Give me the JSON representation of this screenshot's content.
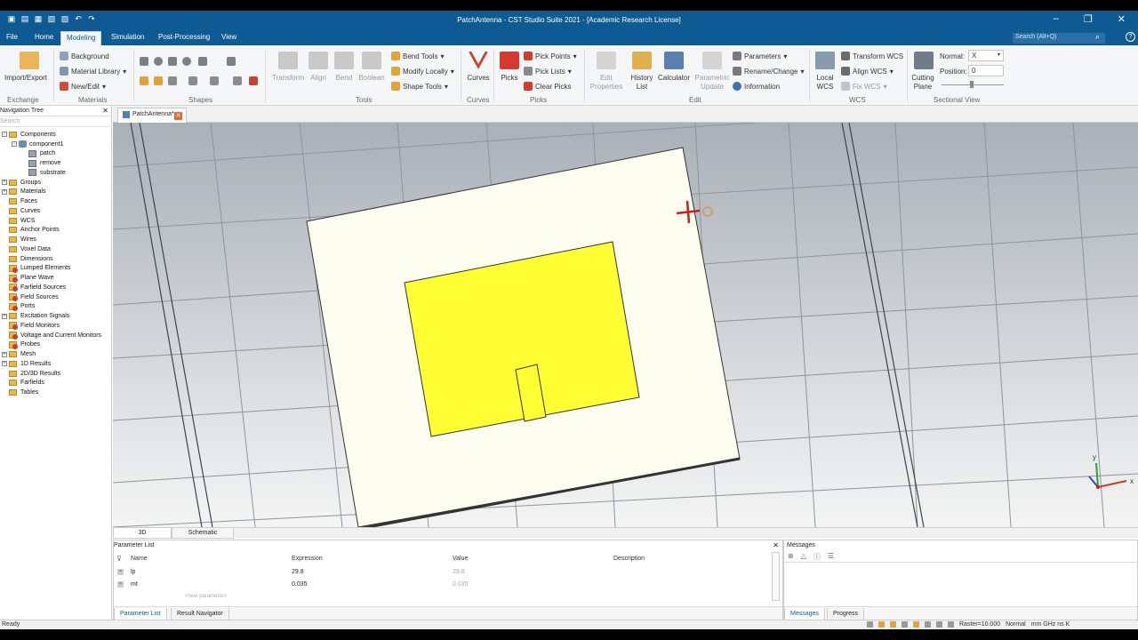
{
  "window": {
    "title": "PatchAntenna - CST Studio Suite 2021 - [Academic Research License]"
  },
  "menu": {
    "tabs": [
      "File",
      "Home",
      "Modeling",
      "Simulation",
      "Post-Processing",
      "View"
    ],
    "active": "Modeling",
    "search_placeholder": "Search (Alt+Q)"
  },
  "ribbon": {
    "exchange": {
      "import_export": "Import/Export",
      "group": "Exchange"
    },
    "materials": {
      "background": "Background",
      "library": "Material Library",
      "new_edit": "New/Edit",
      "group": "Materials"
    },
    "shapes": {
      "group": "Shapes"
    },
    "tools": {
      "transform": "Transform",
      "align": "Align",
      "bend": "Bend",
      "boolean": "Boolean",
      "bend_tools": "Bend Tools",
      "modify_locally": "Modify Locally",
      "shape_tools": "Shape Tools",
      "group": "Tools"
    },
    "curves": {
      "curves": "Curves",
      "group": "Curves"
    },
    "picks": {
      "picks": "Picks",
      "pick_points": "Pick Points",
      "pick_lists": "Pick Lists",
      "clear_picks": "Clear Picks",
      "group": "Picks"
    },
    "edit": {
      "edit_properties_1": "Edit",
      "edit_properties_2": "Properties",
      "history_1": "History",
      "history_2": "List",
      "calculator": "Calculator",
      "param_update_1": "Parametric",
      "param_update_2": "Update",
      "parameters": "Parameters",
      "rename": "Rename/Change",
      "information": "Information",
      "group": "Edit"
    },
    "wcs": {
      "local_1": "Local",
      "local_2": "WCS",
      "transform": "Transform WCS",
      "align": "Align WCS",
      "fix": "Fix WCS",
      "group": "WCS"
    },
    "sectional": {
      "cutting_1": "Cutting",
      "cutting_2": "Plane",
      "normal_label": "Normal:",
      "normal_value": "X",
      "position_label": "Position:",
      "position_value": "0",
      "group": "Sectional View"
    }
  },
  "nav": {
    "title": "Navigation Tree",
    "search_placeholder": "Search",
    "items": [
      {
        "label": "Components",
        "indent": 0,
        "icon": "folder",
        "exp": "-"
      },
      {
        "label": "component1",
        "indent": 1,
        "icon": "component",
        "exp": "-"
      },
      {
        "label": "patch",
        "indent": 2,
        "icon": "solid",
        "exp": ""
      },
      {
        "label": "remove",
        "indent": 2,
        "icon": "solid",
        "exp": ""
      },
      {
        "label": "substrate",
        "indent": 2,
        "icon": "solid",
        "exp": ""
      },
      {
        "label": "Groups",
        "indent": 0,
        "icon": "folder",
        "exp": "+"
      },
      {
        "label": "Materials",
        "indent": 0,
        "icon": "folder",
        "exp": "+"
      },
      {
        "label": "Faces",
        "indent": 0,
        "icon": "folder",
        "exp": ""
      },
      {
        "label": "Curves",
        "indent": 0,
        "icon": "folder",
        "exp": ""
      },
      {
        "label": "WCS",
        "indent": 0,
        "icon": "folder",
        "exp": ""
      },
      {
        "label": "Anchor Points",
        "indent": 0,
        "icon": "folder",
        "exp": ""
      },
      {
        "label": "Wires",
        "indent": 0,
        "icon": "folder",
        "exp": ""
      },
      {
        "label": "Voxel Data",
        "indent": 0,
        "icon": "folder",
        "exp": ""
      },
      {
        "label": "Dimensions",
        "indent": 0,
        "icon": "folder",
        "exp": ""
      },
      {
        "label": "Lumped Elements",
        "indent": 0,
        "icon": "red",
        "exp": ""
      },
      {
        "label": "Plane Wave",
        "indent": 0,
        "icon": "red",
        "exp": ""
      },
      {
        "label": "Farfield Sources",
        "indent": 0,
        "icon": "red",
        "exp": ""
      },
      {
        "label": "Field Sources",
        "indent": 0,
        "icon": "red",
        "exp": ""
      },
      {
        "label": "Ports",
        "indent": 0,
        "icon": "red",
        "exp": ""
      },
      {
        "label": "Excitation Signals",
        "indent": 0,
        "icon": "folder",
        "exp": "+"
      },
      {
        "label": "Field Monitors",
        "indent": 0,
        "icon": "red",
        "exp": ""
      },
      {
        "label": "Voltage and Current Monitors",
        "indent": 0,
        "icon": "red",
        "exp": ""
      },
      {
        "label": "Probes",
        "indent": 0,
        "icon": "red",
        "exp": ""
      },
      {
        "label": "Mesh",
        "indent": 0,
        "icon": "folder",
        "exp": "+"
      },
      {
        "label": "1D Results",
        "indent": 0,
        "icon": "folder",
        "exp": "+"
      },
      {
        "label": "2D/3D Results",
        "indent": 0,
        "icon": "folder",
        "exp": ""
      },
      {
        "label": "Farfields",
        "indent": 0,
        "icon": "folder",
        "exp": ""
      },
      {
        "label": "Tables",
        "indent": 0,
        "icon": "folder",
        "exp": ""
      }
    ]
  },
  "doc": {
    "tab": "PatchAntenna*"
  },
  "view_tabs": [
    "3D",
    "Schematic"
  ],
  "params": {
    "title": "Parameter List",
    "headers": {
      "name": "Name",
      "expression": "Expression",
      "value": "Value",
      "description": "Description"
    },
    "rows": [
      {
        "name": "lp",
        "expression": "29.8",
        "value": "29.8"
      },
      {
        "name": "mt",
        "expression": "0.035",
        "value": "0.035"
      }
    ],
    "new_row": "<new parameter>",
    "tabs": [
      "Parameter List",
      "Result Navigator"
    ]
  },
  "messages": {
    "title": "Messages",
    "tabs": [
      "Messages",
      "Progress"
    ]
  },
  "status": {
    "left": "Ready",
    "raster": "Raster=10.000",
    "mode": "Normal",
    "units": "mm  GHz  ns  K"
  },
  "colors": {
    "titlebar": "#0e5a93",
    "substrate": "#fdfdf0",
    "patch": "#ffff33",
    "axis_x": "#d0392b",
    "axis_y": "#2e9c3c",
    "axis_z": "#2a4fc0"
  }
}
